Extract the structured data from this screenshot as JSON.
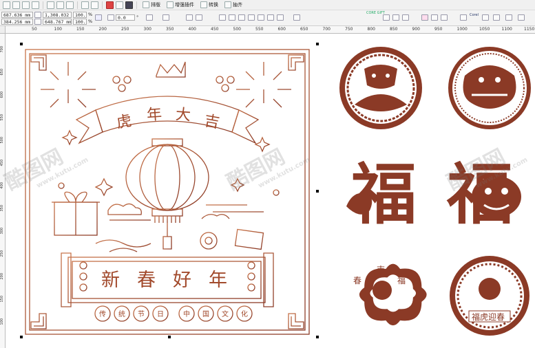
{
  "toolbar": {
    "menu_items": [
      {
        "label": "排版"
      },
      {
        "label": "增强插件"
      },
      {
        "label": "转换"
      },
      {
        "label": "抽齐"
      }
    ],
    "right_labels": {
      "core_gift": "CORE GIFT",
      "plugin": "Corel"
    }
  },
  "property_bar": {
    "x_value": "687.636 mm",
    "y_value": "384.256 mm",
    "width_value": "1,308.032 mm",
    "height_value": "648.767 mm",
    "scale_x": "100.0",
    "scale_y": "100.0",
    "percent": "%",
    "angle_value": "0.0",
    "angle_unit": "°"
  },
  "ruler": {
    "top_ticks": [
      "50",
      "100",
      "150",
      "200",
      "250",
      "300",
      "350",
      "400",
      "450",
      "500",
      "550",
      "600",
      "650",
      "700",
      "750",
      "800",
      "850",
      "900",
      "950",
      "1000",
      "1050",
      "1100",
      "1150"
    ],
    "left_ticks": [
      "700",
      "650",
      "600",
      "550",
      "500",
      "450",
      "400",
      "350",
      "300",
      "250",
      "200",
      "150",
      "100"
    ]
  },
  "artwork": {
    "banner_text": [
      "虎",
      "年",
      "大",
      "吉"
    ],
    "scroll_text": [
      "新",
      "春",
      "好",
      "年"
    ],
    "bottom_circles": [
      "传",
      "统",
      "节",
      "日",
      "中",
      "国",
      "文",
      "化"
    ],
    "seal_left": [
      "春",
      "福",
      "吉"
    ],
    "seal_right": "福虎迎春",
    "fu_char": "福"
  },
  "watermark": {
    "brand": "酷图网",
    "url": "www.kutu.com"
  },
  "colors": {
    "artwork_brown": "#8b3a26",
    "line_copper": "#b1572f"
  }
}
